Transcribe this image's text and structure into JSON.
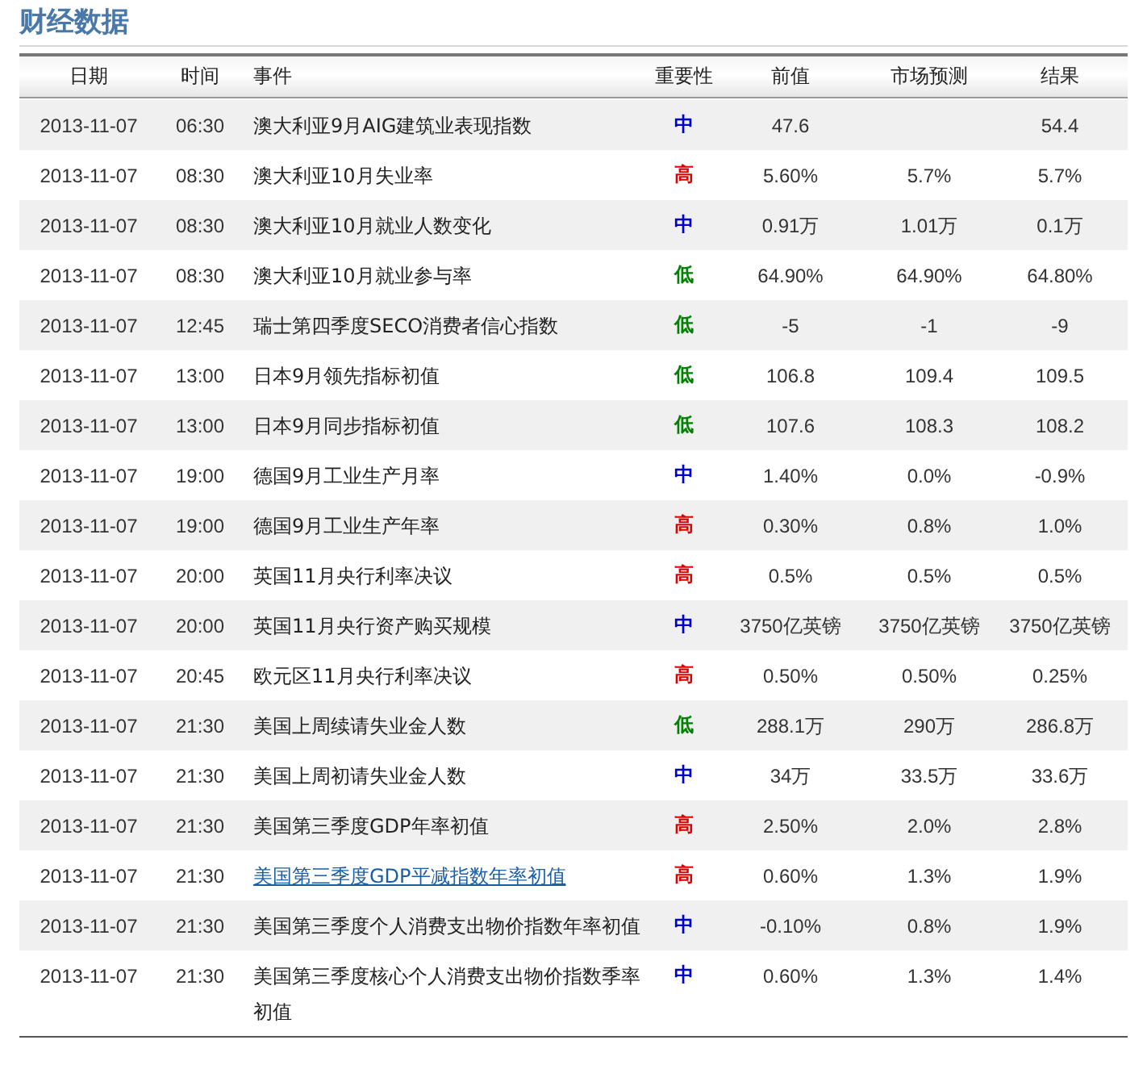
{
  "title": "财经数据",
  "columns": [
    "日期",
    "时间",
    "事件",
    "重要性",
    "前值",
    "市场预测",
    "结果"
  ],
  "rows": [
    {
      "date": "2013-11-07",
      "time": "06:30",
      "event": "澳大利亚9月AIG建筑业表现指数",
      "link": false,
      "importance": {
        "label": "中",
        "color": "#0000cc"
      },
      "previous": "47.6",
      "result": "54.4"
    },
    {
      "date": "2013-11-07",
      "time": "08:30",
      "event": "澳大利亚10月失业率",
      "link": false,
      "importance": {
        "label": "高",
        "color": "#dd0000"
      },
      "previous": "5.60%",
      "forecast": "5.7%",
      "result": "5.7%"
    },
    {
      "date": "2013-11-07",
      "time": "08:30",
      "event": "澳大利亚10月就业人数变化",
      "link": false,
      "importance": {
        "label": "中",
        "color": "#0000cc"
      },
      "previous": "0.91万",
      "forecast": "1.01万",
      "result": "0.1万"
    },
    {
      "date": "2013-11-07",
      "time": "08:30",
      "event": "澳大利亚10月就业参与率",
      "link": false,
      "importance": {
        "label": "低",
        "color": "#008000"
      },
      "previous": "64.90%",
      "forecast": "64.90%",
      "result": "64.80%"
    },
    {
      "date": "2013-11-07",
      "time": "12:45",
      "event": "瑞士第四季度SECO消费者信心指数",
      "link": false,
      "importance": {
        "label": "低",
        "color": "#008000"
      },
      "previous": "-5",
      "forecast": "-1",
      "result": "-9"
    },
    {
      "date": "2013-11-07",
      "time": "13:00",
      "event": "日本9月领先指标初值",
      "link": false,
      "importance": {
        "label": "低",
        "color": "#008000"
      },
      "previous": "106.8",
      "forecast": "109.4",
      "result": "109.5"
    },
    {
      "date": "2013-11-07",
      "time": "13:00",
      "event": "日本9月同步指标初值",
      "link": false,
      "importance": {
        "label": "低",
        "color": "#008000"
      },
      "previous": "107.6",
      "forecast": "108.3",
      "result": "108.2"
    },
    {
      "date": "2013-11-07",
      "time": "19:00",
      "event": "德国9月工业生产月率",
      "link": false,
      "importance": {
        "label": "中",
        "color": "#0000cc"
      },
      "previous": "1.40%",
      "forecast": "0.0%",
      "result": "-0.9%"
    },
    {
      "date": "2013-11-07",
      "time": "19:00",
      "event": "德国9月工业生产年率",
      "link": false,
      "importance": {
        "label": "高",
        "color": "#dd0000"
      },
      "previous": "0.30%",
      "forecast": "0.8%",
      "result": "1.0%"
    },
    {
      "date": "2013-11-07",
      "time": "20:00",
      "event": "英国11月央行利率决议",
      "link": false,
      "importance": {
        "label": "高",
        "color": "#dd0000"
      },
      "previous": "0.5%",
      "forecast": "0.5%",
      "result": "0.5%"
    },
    {
      "date": "2013-11-07",
      "time": "20:00",
      "event": "英国11月央行资产购买规模",
      "link": false,
      "importance": {
        "label": "中",
        "color": "#0000cc"
      },
      "previous": "3750亿英镑",
      "forecast": "3750亿英镑",
      "result": "3750亿英镑"
    },
    {
      "date": "2013-11-07",
      "time": "20:45",
      "event": "欧元区11月央行利率决议",
      "link": false,
      "importance": {
        "label": "高",
        "color": "#dd0000"
      },
      "previous": "0.50%",
      "forecast": "0.50%",
      "result": "0.25%"
    },
    {
      "date": "2013-11-07",
      "time": "21:30",
      "event": "美国上周续请失业金人数",
      "link": false,
      "importance": {
        "label": "低",
        "color": "#008000"
      },
      "previous": "288.1万",
      "forecast": "290万",
      "result": "286.8万"
    },
    {
      "date": "2013-11-07",
      "time": "21:30",
      "event": "美国上周初请失业金人数",
      "link": false,
      "importance": {
        "label": "中",
        "color": "#0000cc"
      },
      "previous": "34万",
      "forecast": "33.5万",
      "result": "33.6万"
    },
    {
      "date": "2013-11-07",
      "time": "21:30",
      "event": "美国第三季度GDP年率初值",
      "link": false,
      "importance": {
        "label": "高",
        "color": "#dd0000"
      },
      "previous": "2.50%",
      "forecast": "2.0%",
      "result": "2.8%"
    },
    {
      "date": "2013-11-07",
      "time": "21:30",
      "event": "美国第三季度GDP平减指数年率初值",
      "link": true,
      "importance": {
        "label": "高",
        "color": "#dd0000"
      },
      "previous": "0.60%",
      "forecast": "1.3%",
      "result": "1.9%"
    },
    {
      "date": "2013-11-07",
      "time": "21:30",
      "event": "美国第三季度个人消费支出物价指数年率初值",
      "link": false,
      "importance": {
        "label": "中",
        "color": "#0000cc"
      },
      "previous": "-0.10%",
      "forecast": "0.8%",
      "result": "1.9%"
    },
    {
      "date": "2013-11-07",
      "time": "21:30",
      "event": "美国第三季度核心个人消费支出物价指数季率初值",
      "link": false,
      "importance": {
        "label": "中",
        "color": "#0000cc"
      },
      "previous": "0.60%",
      "forecast": "1.3%",
      "result": "1.4%"
    }
  ]
}
